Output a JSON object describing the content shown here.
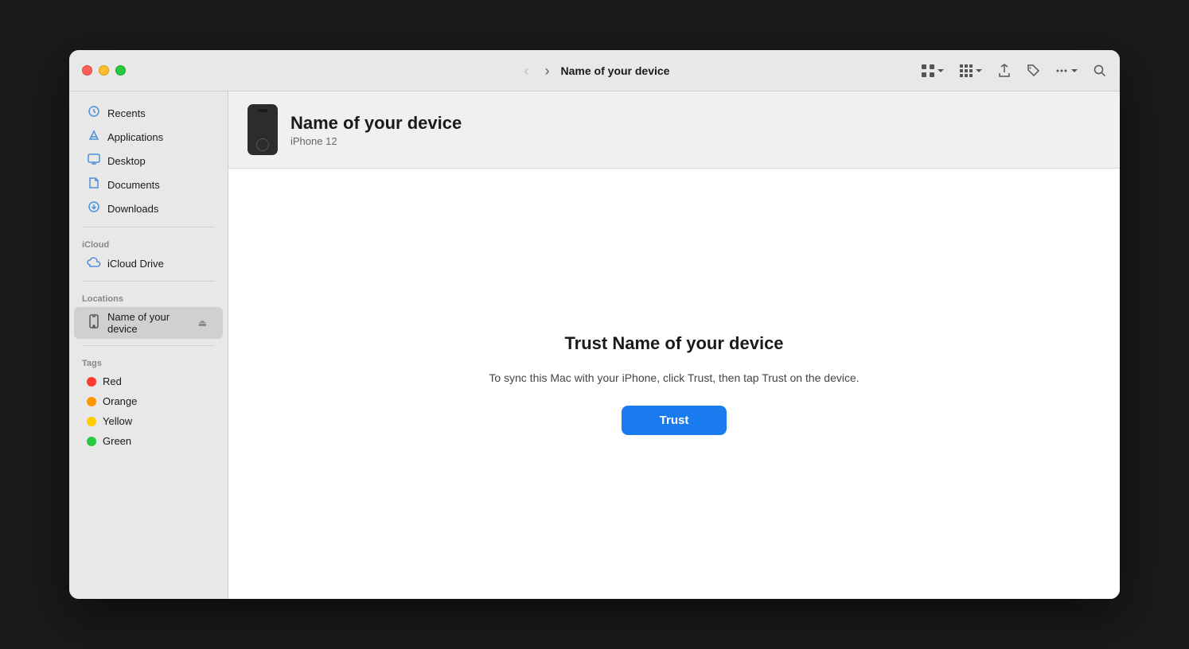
{
  "window": {
    "title": "Name of your device"
  },
  "titlebar": {
    "back_label": "‹",
    "forward_label": "›",
    "title": "Name of your device",
    "icons": {
      "grid": "⊞",
      "grid2": "⊞",
      "share": "↑",
      "tag": "⬡",
      "more": "•••",
      "search": "⌕"
    }
  },
  "sidebar": {
    "favorites_label": "",
    "items": [
      {
        "id": "recents",
        "label": "Recents",
        "icon": "🕐",
        "icon_class": "sidebar-icon-recents"
      },
      {
        "id": "applications",
        "label": "Applications",
        "icon": "⚡",
        "icon_class": "sidebar-icon-apps"
      },
      {
        "id": "desktop",
        "label": "Desktop",
        "icon": "🖥",
        "icon_class": "sidebar-icon-desktop"
      },
      {
        "id": "documents",
        "label": "Documents",
        "icon": "📄",
        "icon_class": "sidebar-icon-documents"
      },
      {
        "id": "downloads",
        "label": "Downloads",
        "icon": "⬇",
        "icon_class": "sidebar-icon-downloads"
      }
    ],
    "icloud_label": "iCloud",
    "icloud_items": [
      {
        "id": "icloud-drive",
        "label": "iCloud Drive",
        "icon": "☁"
      }
    ],
    "locations_label": "Locations",
    "location_items": [
      {
        "id": "device",
        "label": "Name of your device",
        "icon": "📱",
        "active": true
      }
    ],
    "tags_label": "Tags",
    "tag_items": [
      {
        "id": "red",
        "label": "Red",
        "color": "#ff3b30"
      },
      {
        "id": "orange",
        "label": "Orange",
        "color": "#ff9500"
      },
      {
        "id": "yellow",
        "label": "Yellow",
        "color": "#ffcc00"
      },
      {
        "id": "green",
        "label": "Green",
        "color": "#28c840"
      }
    ]
  },
  "device": {
    "name": "Name of your device",
    "model": "iPhone 12"
  },
  "trust_dialog": {
    "title": "Trust Name of your device",
    "description": "To sync this Mac with your iPhone, click Trust, then tap Trust on the device.",
    "trust_button_label": "Trust"
  }
}
